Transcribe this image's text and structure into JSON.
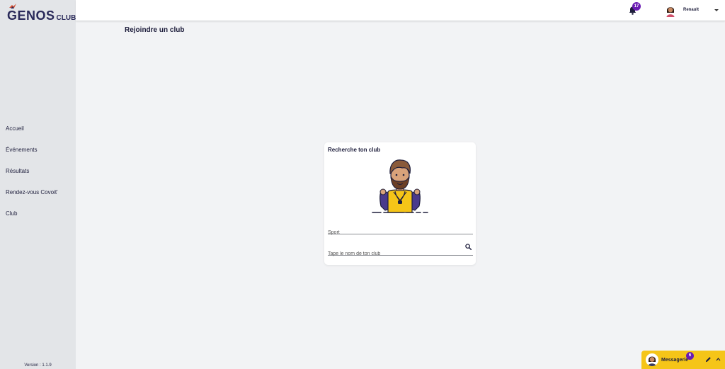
{
  "app": {
    "logo_text": "GENOS",
    "logo_sub": "CLUBS",
    "version": "Version : 1.1.9"
  },
  "sidebar": {
    "items": [
      {
        "label": "Accueil"
      },
      {
        "label": "Événements"
      },
      {
        "label": "Résultats"
      },
      {
        "label": "Rendez-vous Covoit'"
      },
      {
        "label": "Club"
      }
    ]
  },
  "topbar": {
    "notification_count": "17",
    "user_name": "Renault"
  },
  "page": {
    "title": "Rejoindre un club"
  },
  "search_card": {
    "title": "Recherche ton club",
    "sport_placeholder": "Sport",
    "club_placeholder": "Tape le nom de ton club"
  },
  "messaging": {
    "label": "Messagerie",
    "unread_count": "6"
  },
  "colors": {
    "sidebar_bg": "#e3e5e8",
    "page_bg": "#f2f3f5",
    "badge_purple": "#6a1bb3",
    "messaging_yellow": "#f5c518",
    "navy_text": "#1e1e3c"
  },
  "icons": {
    "notification": "bell-icon",
    "search": "search-icon",
    "compose": "pencil-icon",
    "collapse": "chevron-up-icon",
    "user_menu": "caret-down-icon"
  }
}
